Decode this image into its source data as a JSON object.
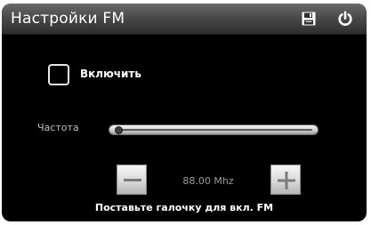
{
  "window": {
    "title": "Настройки FM"
  },
  "toolbar": {
    "save_icon": "floppy-disk-icon",
    "power_icon": "power-icon"
  },
  "enable": {
    "label": "Включить",
    "checked": false
  },
  "frequency": {
    "label": "Частота",
    "value": "88.00 Mhz",
    "slider_fraction": 0.0
  },
  "buttons": {
    "decrease_icon": "minus-icon",
    "increase_icon": "plus-icon"
  },
  "hint": "Поставьте галочку для вкл. FM",
  "colors": {
    "background": "#000000",
    "titlebar": "#4a4a4a",
    "text": "#ffffff",
    "muted_text": "#9a9a9a"
  }
}
